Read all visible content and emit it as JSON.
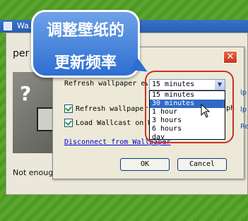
{
  "window": {
    "title": "Wa...",
    "partial_text": "per",
    "not_enough": "Not enougl"
  },
  "callout": {
    "line1": "调整壁纸的",
    "line2": "更新频率"
  },
  "dialog": {
    "close": "✕",
    "refresh_label": "Refresh wallpaper every",
    "refresh_selected": "15 minutes",
    "options": [
      "15 minutes",
      "30 minutes",
      "1 hour",
      "3 hours",
      "6 hours",
      "day"
    ],
    "selected_index": 1,
    "check1_label": "Refresh wallpaper",
    "check1_trailing": "ph",
    "check2_label": "Load Wallcast on W",
    "check1_checked": true,
    "check2_checked": true,
    "disconnect_link": "Disconnect from Wallpaper",
    "ok_label": "OK",
    "cancel_label": "Cancel"
  },
  "side_links": [
    "lp",
    "lp",
    "Re"
  ],
  "colors": {
    "background_green": "#5aa02c",
    "title_bar_blue": "#2a5eb2",
    "highlight_blue": "#316ac5",
    "callout_border_red": "#c8322a"
  }
}
